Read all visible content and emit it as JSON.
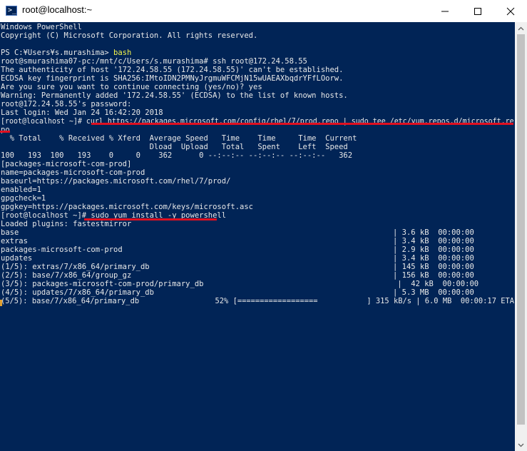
{
  "window": {
    "title": "root@localhost:~",
    "icon": "powershell-icon",
    "buttons": {
      "minimize": "minimize-icon",
      "maximize": "maximize-icon",
      "close": "close-icon"
    }
  },
  "console": {
    "lines": [
      "Windows PowerShell",
      "Copyright (C) Microsoft Corporation. All rights reserved.",
      "",
      "PS C:¥Users¥s.murashima> ",
      "root@smurashima07-pc:/mnt/c/Users/s.murashima# ssh root@172.24.58.55",
      "The authenticity of host '172.24.58.55 (172.24.58.55)' can't be established.",
      "ECDSA key fingerprint is SHA256:IMtoIDN2PMNyJrgmuWFCMjN15wUAEAXbqdrYFfLOorw.",
      "Are you sure you want to continue connecting (yes/no)? yes",
      "Warning: Permanently added '172.24.58.55' (ECDSA) to the list of known hosts.",
      "root@172.24.58.55's password:",
      "Last login: Wed Jan 24 16:42:20 2018",
      "[root@localhost ~]# curl https://packages.microsoft.com/config/rhel/7/prod.repo | sudo tee /etc/yum.repos.d/microsoft.re",
      "po",
      "  % Total    % Received % Xferd  Average Speed   Time    Time     Time  Current",
      "                                 Dload  Upload   Total   Spent    Left  Speed",
      "100   193  100   193    0     0    362      0 --:--:-- --:--:-- --:--:--   362",
      "[packages-microsoft-com-prod]",
      "name=packages-microsoft-com-prod",
      "baseurl=https://packages.microsoft.com/rhel/7/prod/",
      "enabled=1",
      "gpgcheck=1",
      "gpgkey=https://packages.microsoft.com/keys/microsoft.asc",
      "[root@localhost ~]# sudo yum install -y powershell",
      "Loaded plugins: fastestmirror",
      "base                                                                                   | 3.6 kB  00:00:00",
      "extras                                                                                 | 3.4 kB  00:00:00",
      "packages-microsoft-com-prod                                                            | 2.9 kB  00:00:00",
      "updates                                                                                | 3.4 kB  00:00:00",
      "(1/5): extras/7/x86_64/primary_db                                                      | 145 kB  00:00:00",
      "(2/5): base/7/x86_64/group_gz                                                          | 156 kB  00:00:00",
      "(3/5): packages-microsoft-com-prod/primary_db                                           |  42 kB  00:00:00",
      "(4/5): updates/7/x86_64/primary_db                                                     | 5.3 MB  00:00:00",
      "(5/5): base/7/x86_64/primary_db                 52% [==================           ] 315 kB/s | 6.0 MB  00:00:17 ETA"
    ],
    "ps_command": "bash"
  },
  "colors": {
    "console_bg": "#012456",
    "console_fg": "#e8e8e8",
    "command_highlight": "#f5f54a",
    "annotation_underline": "#e01020"
  }
}
